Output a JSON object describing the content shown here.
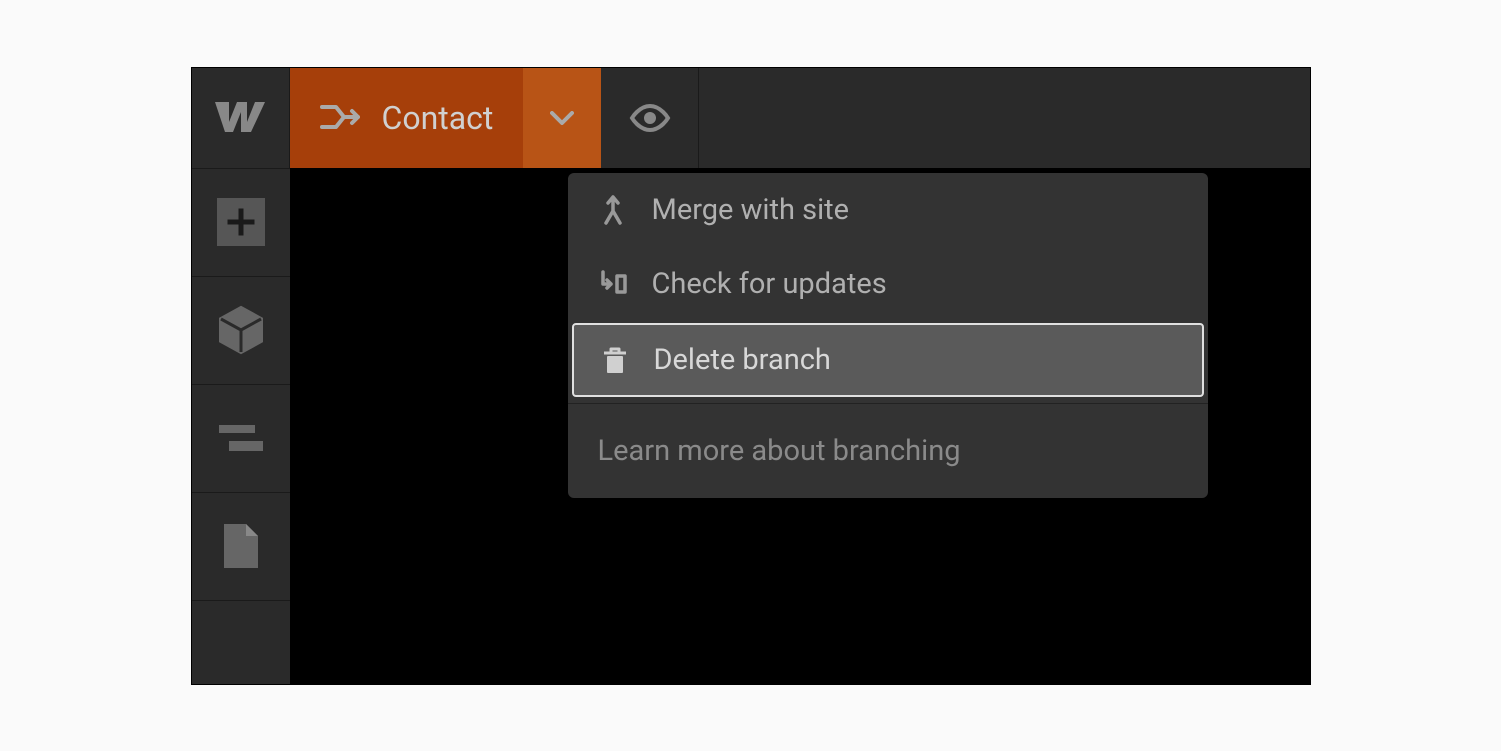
{
  "header": {
    "page_label": "Contact"
  },
  "menu": {
    "merge_label": "Merge with site",
    "check_updates_label": "Check for updates",
    "delete_branch_label": "Delete branch",
    "learn_more_label": "Learn more about branching"
  },
  "icons": {
    "logo": "webflow-logo-icon",
    "branch": "branch-icon",
    "chevron_down": "chevron-down-icon",
    "eye": "eye-icon",
    "add": "plus-icon",
    "cube": "cube-icon",
    "navigator": "navigator-icon",
    "page": "page-icon",
    "merge": "merge-icon",
    "update": "update-icon",
    "trash": "trash-icon"
  }
}
